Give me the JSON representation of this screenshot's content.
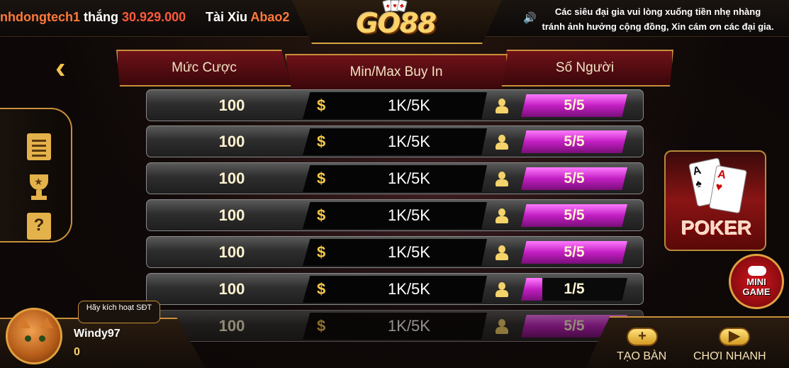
{
  "ticker": {
    "name": "nhdongtech1",
    "verb": "thắng",
    "amount": "30.929.000"
  },
  "recent": {
    "label": "Tài Xỉu",
    "name": "Abao2"
  },
  "logo": {
    "text": "GO88"
  },
  "notice": {
    "line1": "Các siêu đại gia vui lòng xuống tiền nhẹ nhàng",
    "line2": "tránh ảnh hưởng cộng đồng, Xin cám ơn các đại gia."
  },
  "icons": {
    "speaker": "speaker-icon",
    "back": "back-chevron-icon",
    "doc": "document-icon",
    "trophy": "trophy-icon",
    "help": "help-icon",
    "person": "person-icon",
    "dollar": "dollar-icon"
  },
  "table": {
    "headers": {
      "bet": "Mức Cược",
      "buyin": "Min/Max Buy In",
      "players": "Số Người"
    },
    "rows": [
      {
        "bet": "100",
        "buyin": "1K/5K",
        "players": "5/5",
        "fill": 1.0
      },
      {
        "bet": "100",
        "buyin": "1K/5K",
        "players": "5/5",
        "fill": 1.0
      },
      {
        "bet": "100",
        "buyin": "1K/5K",
        "players": "5/5",
        "fill": 1.0
      },
      {
        "bet": "100",
        "buyin": "1K/5K",
        "players": "5/5",
        "fill": 1.0
      },
      {
        "bet": "100",
        "buyin": "1K/5K",
        "players": "5/5",
        "fill": 1.0
      },
      {
        "bet": "100",
        "buyin": "1K/5K",
        "players": "1/5",
        "fill": 0.2
      },
      {
        "bet": "100",
        "buyin": "1K/5K",
        "players": "5/5",
        "fill": 1.0
      }
    ]
  },
  "game_tile": {
    "label": "POKER"
  },
  "mini_game": {
    "line1": "MINI",
    "line2": "GAME"
  },
  "user": {
    "activate": "Hãy kích hoạt SĐT",
    "name": "Windy97",
    "balance": "0"
  },
  "actions": {
    "create": "TẠO BÀN",
    "quick": "CHƠI NHANH"
  }
}
